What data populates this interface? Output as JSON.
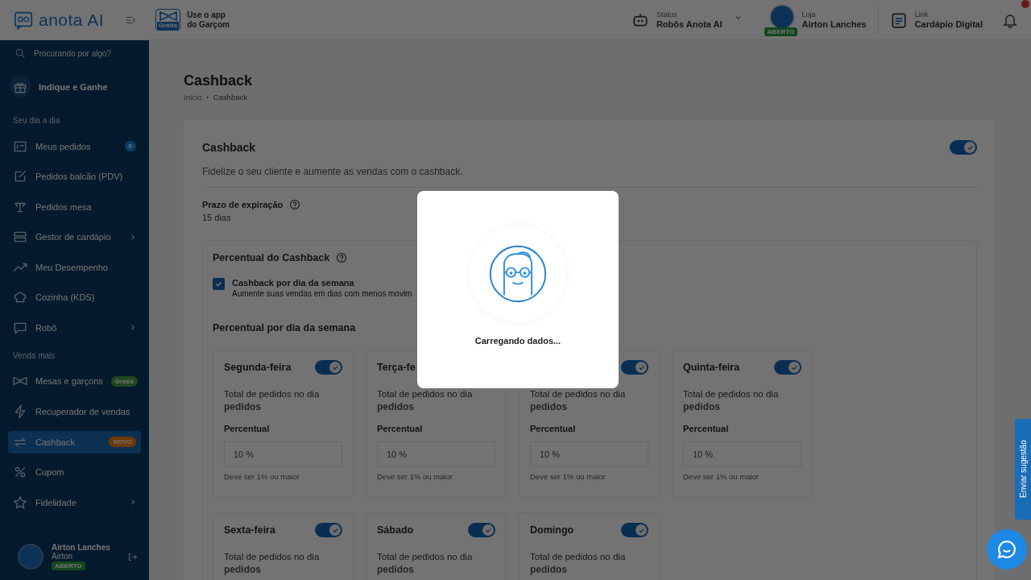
{
  "topbar": {
    "logo": "anota AI",
    "waiter_app": {
      "badge": "Grátis",
      "line1": "Use o app",
      "line2": "do Garçom"
    },
    "status": {
      "label": "Status",
      "value": "Robôs Anota AI"
    },
    "store": {
      "label": "Loja",
      "value": "Airton Lanches",
      "badge": "ABERTO"
    },
    "link": {
      "label": "Link",
      "value": "Cardápio Digital"
    },
    "notifications": {
      "unread": true
    }
  },
  "sidebar": {
    "search": {
      "placeholder": "Procurando por algo?"
    },
    "items": [
      {
        "kind": "highlight",
        "label": "Indique e Ganhe",
        "selected": false
      },
      {
        "kind": "section",
        "label": "Seu dia a dia"
      },
      {
        "kind": "item",
        "label": "Meus pedidos",
        "badge": {
          "text": "0",
          "color": "#0d3d67"
        },
        "selected": false,
        "has_submenu": false
      },
      {
        "kind": "item",
        "label": "Pedidos balcão (PDV)",
        "selected": false,
        "has_submenu": false
      },
      {
        "kind": "item",
        "label": "Pedidos mesa",
        "selected": false,
        "has_submenu": false
      },
      {
        "kind": "item",
        "label": "Gestor de cardápio",
        "selected": false,
        "has_submenu": true
      },
      {
        "kind": "item",
        "label": "Meu Desempenho",
        "selected": false,
        "has_submenu": false
      },
      {
        "kind": "item",
        "label": "Cozinha (KDS)",
        "selected": false,
        "has_submenu": false
      },
      {
        "kind": "item",
        "label": "Robô",
        "selected": false,
        "has_submenu": true
      },
      {
        "kind": "section",
        "label": "Venda mais"
      },
      {
        "kind": "item",
        "label": "Mesas e garçons",
        "badge": {
          "text": "Grátis",
          "color": "#1e4820"
        },
        "selected": false,
        "has_submenu": false
      },
      {
        "kind": "item",
        "label": "Recuperador de vendas",
        "selected": false,
        "has_submenu": false
      },
      {
        "kind": "item",
        "label": "Cashback",
        "badge": {
          "text": "NOVO",
          "color": "#6e3800"
        },
        "selected": true,
        "has_submenu": false
      },
      {
        "kind": "item",
        "label": "Cupom",
        "selected": false,
        "has_submenu": false
      },
      {
        "kind": "item",
        "label": "Fidelidade",
        "selected": false,
        "has_submenu": true
      }
    ],
    "user": {
      "store": "Airton Lanches",
      "name": "Airton",
      "badge": "ABERTO"
    }
  },
  "page": {
    "title": "Cashback",
    "breadcrumb": [
      "Início",
      "Cashback"
    ],
    "card": {
      "title": "Cashback",
      "enabled": true,
      "description": "Fidelize o seu cliente e aumente as vendas com o cashback.",
      "expiry_label": "Prazo de expiração",
      "expiry_value": "15 dias",
      "percent_title": "Percentual do Cashback",
      "weekday_option": {
        "label": "Cashback por dia da semana",
        "description": "Aumente suas vendas em dias com menos movim",
        "checked": true
      },
      "days_title": "Percentual por dia da semana",
      "days": [
        {
          "name": "Segunda-feira",
          "enabled": true,
          "metric": "Total de pedidos no dia",
          "unit": "pedidos",
          "field_label": "Percentual",
          "value": "10 %",
          "hint": "Deve ser 1% ou maior"
        },
        {
          "name": "Terça-fe",
          "metric": "Total de pedidos no dia",
          "unit": "pedidos",
          "field_label": "Percentual",
          "value": "10 %",
          "hint": "Deve ser 1% ou maior"
        },
        {
          "enabled": true,
          "metric": "Total de pedidos no dia",
          "unit": "pedidos",
          "field_label": "Percentual",
          "value": "10 %",
          "hint": "Deve ser 1% ou maior"
        },
        {
          "name": "Quinta-feira",
          "enabled": true,
          "metric": "Total de pedidos no dia",
          "unit": "pedidos",
          "field_label": "Percentual",
          "value": "10 %",
          "hint": "Deve ser 1% ou maior"
        },
        {
          "name": "Sexta-feira",
          "enabled": true,
          "metric": "Total de pedidos no dia",
          "unit": "pedidos"
        },
        {
          "name": "Sábado",
          "enabled": true,
          "metric": "Total de pedidos no dia",
          "unit": "pedidos"
        },
        {
          "name": "Domingo",
          "enabled": true,
          "metric": "Total de pedidos no dia",
          "unit": "pedidos"
        }
      ]
    }
  },
  "loading": {
    "text": "Carregando dados..."
  },
  "feedback_tab": "Enviar sugestão"
}
